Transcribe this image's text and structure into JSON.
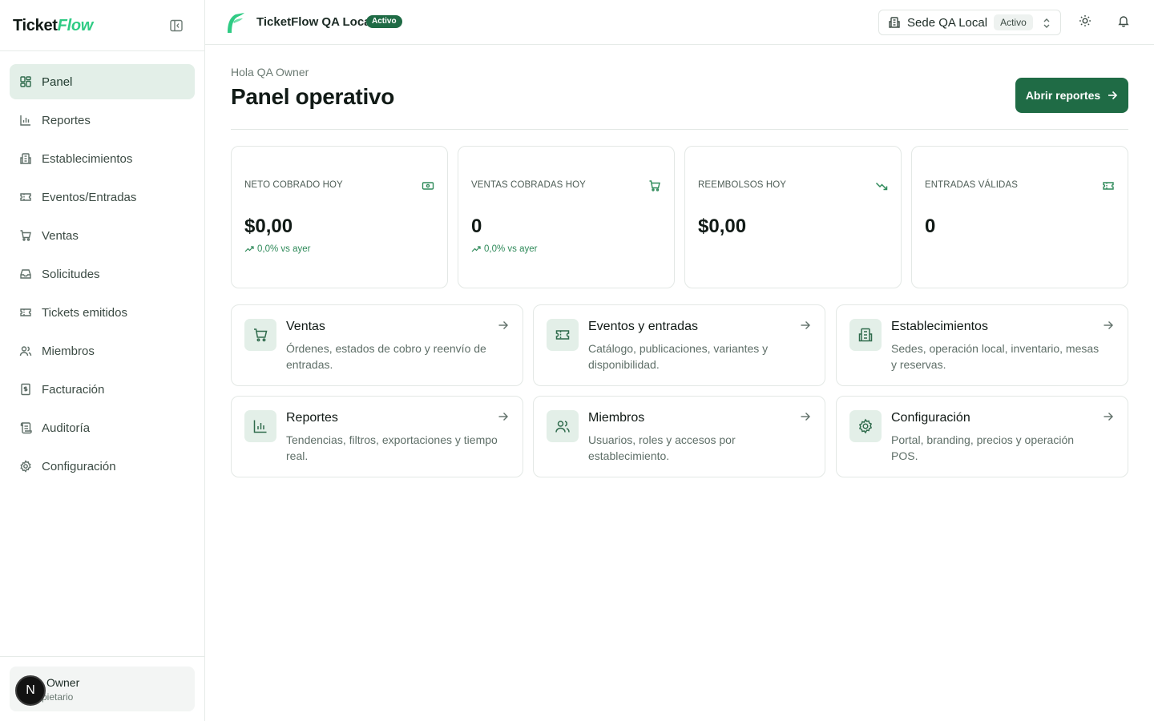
{
  "brand": {
    "part1": "Ticket",
    "part2": "Flow"
  },
  "sidebar": {
    "items": [
      {
        "label": "Panel",
        "icon": "dashboard-icon",
        "active": true
      },
      {
        "label": "Reportes",
        "icon": "bar-chart-icon"
      },
      {
        "label": "Establecimientos",
        "icon": "building-icon"
      },
      {
        "label": "Eventos/Entradas",
        "icon": "ticket-icon"
      },
      {
        "label": "Ventas",
        "icon": "cart-icon"
      },
      {
        "label": "Solicitudes",
        "icon": "inbox-icon"
      },
      {
        "label": "Tickets emitidos",
        "icon": "ticket-icon"
      },
      {
        "label": "Miembros",
        "icon": "users-icon"
      },
      {
        "label": "Facturación",
        "icon": "receipt-icon"
      },
      {
        "label": "Auditoría",
        "icon": "scroll-icon"
      },
      {
        "label": "Configuración",
        "icon": "gear-icon"
      }
    ]
  },
  "user": {
    "avatar_initial": "N",
    "name": "Owner",
    "role": "pietario"
  },
  "topbar": {
    "org_name": "TicketFlow QA Local",
    "org_status": "Activo",
    "sede_name": "Sede QA Local",
    "sede_status": "Activo"
  },
  "main": {
    "greeting": "Hola QA Owner",
    "title": "Panel operativo",
    "primary_button": "Abrir reportes"
  },
  "kpis": [
    {
      "label": "NETO COBRADO HOY",
      "value": "$0,00",
      "delta": "0,0% vs ayer",
      "icon": "banknote-icon"
    },
    {
      "label": "VENTAS COBRADAS HOY",
      "value": "0",
      "delta": "0,0% vs ayer",
      "icon": "cart-icon"
    },
    {
      "label": "REEMBOLSOS HOY",
      "value": "$0,00",
      "delta": "",
      "icon": "trending-down-icon"
    },
    {
      "label": "ENTRADAS VÁLIDAS",
      "value": "0",
      "delta": "",
      "icon": "ticket-icon"
    }
  ],
  "cards": [
    {
      "title": "Ventas",
      "desc": "Órdenes, estados de cobro y reenvío de entradas.",
      "icon": "cart-icon"
    },
    {
      "title": "Eventos y entradas",
      "desc": "Catálogo, publicaciones, variantes y disponibilidad.",
      "icon": "ticket-icon"
    },
    {
      "title": "Establecimientos",
      "desc": "Sedes, operación local, inventario, mesas y reservas.",
      "icon": "building-icon"
    },
    {
      "title": "Reportes",
      "desc": "Tendencias, filtros, exportaciones y tiempo real.",
      "icon": "bar-chart-icon"
    },
    {
      "title": "Miembros",
      "desc": "Usuarios, roles y accesos por establecimiento.",
      "icon": "users-icon"
    },
    {
      "title": "Configuración",
      "desc": "Portal, branding, precios y operación POS.",
      "icon": "gear-icon"
    }
  ],
  "colors": {
    "accent": "#1f6b45",
    "accent_soft": "#e3efe8",
    "positive": "#2f8a5a",
    "brand_flow": "#2fcb84"
  }
}
